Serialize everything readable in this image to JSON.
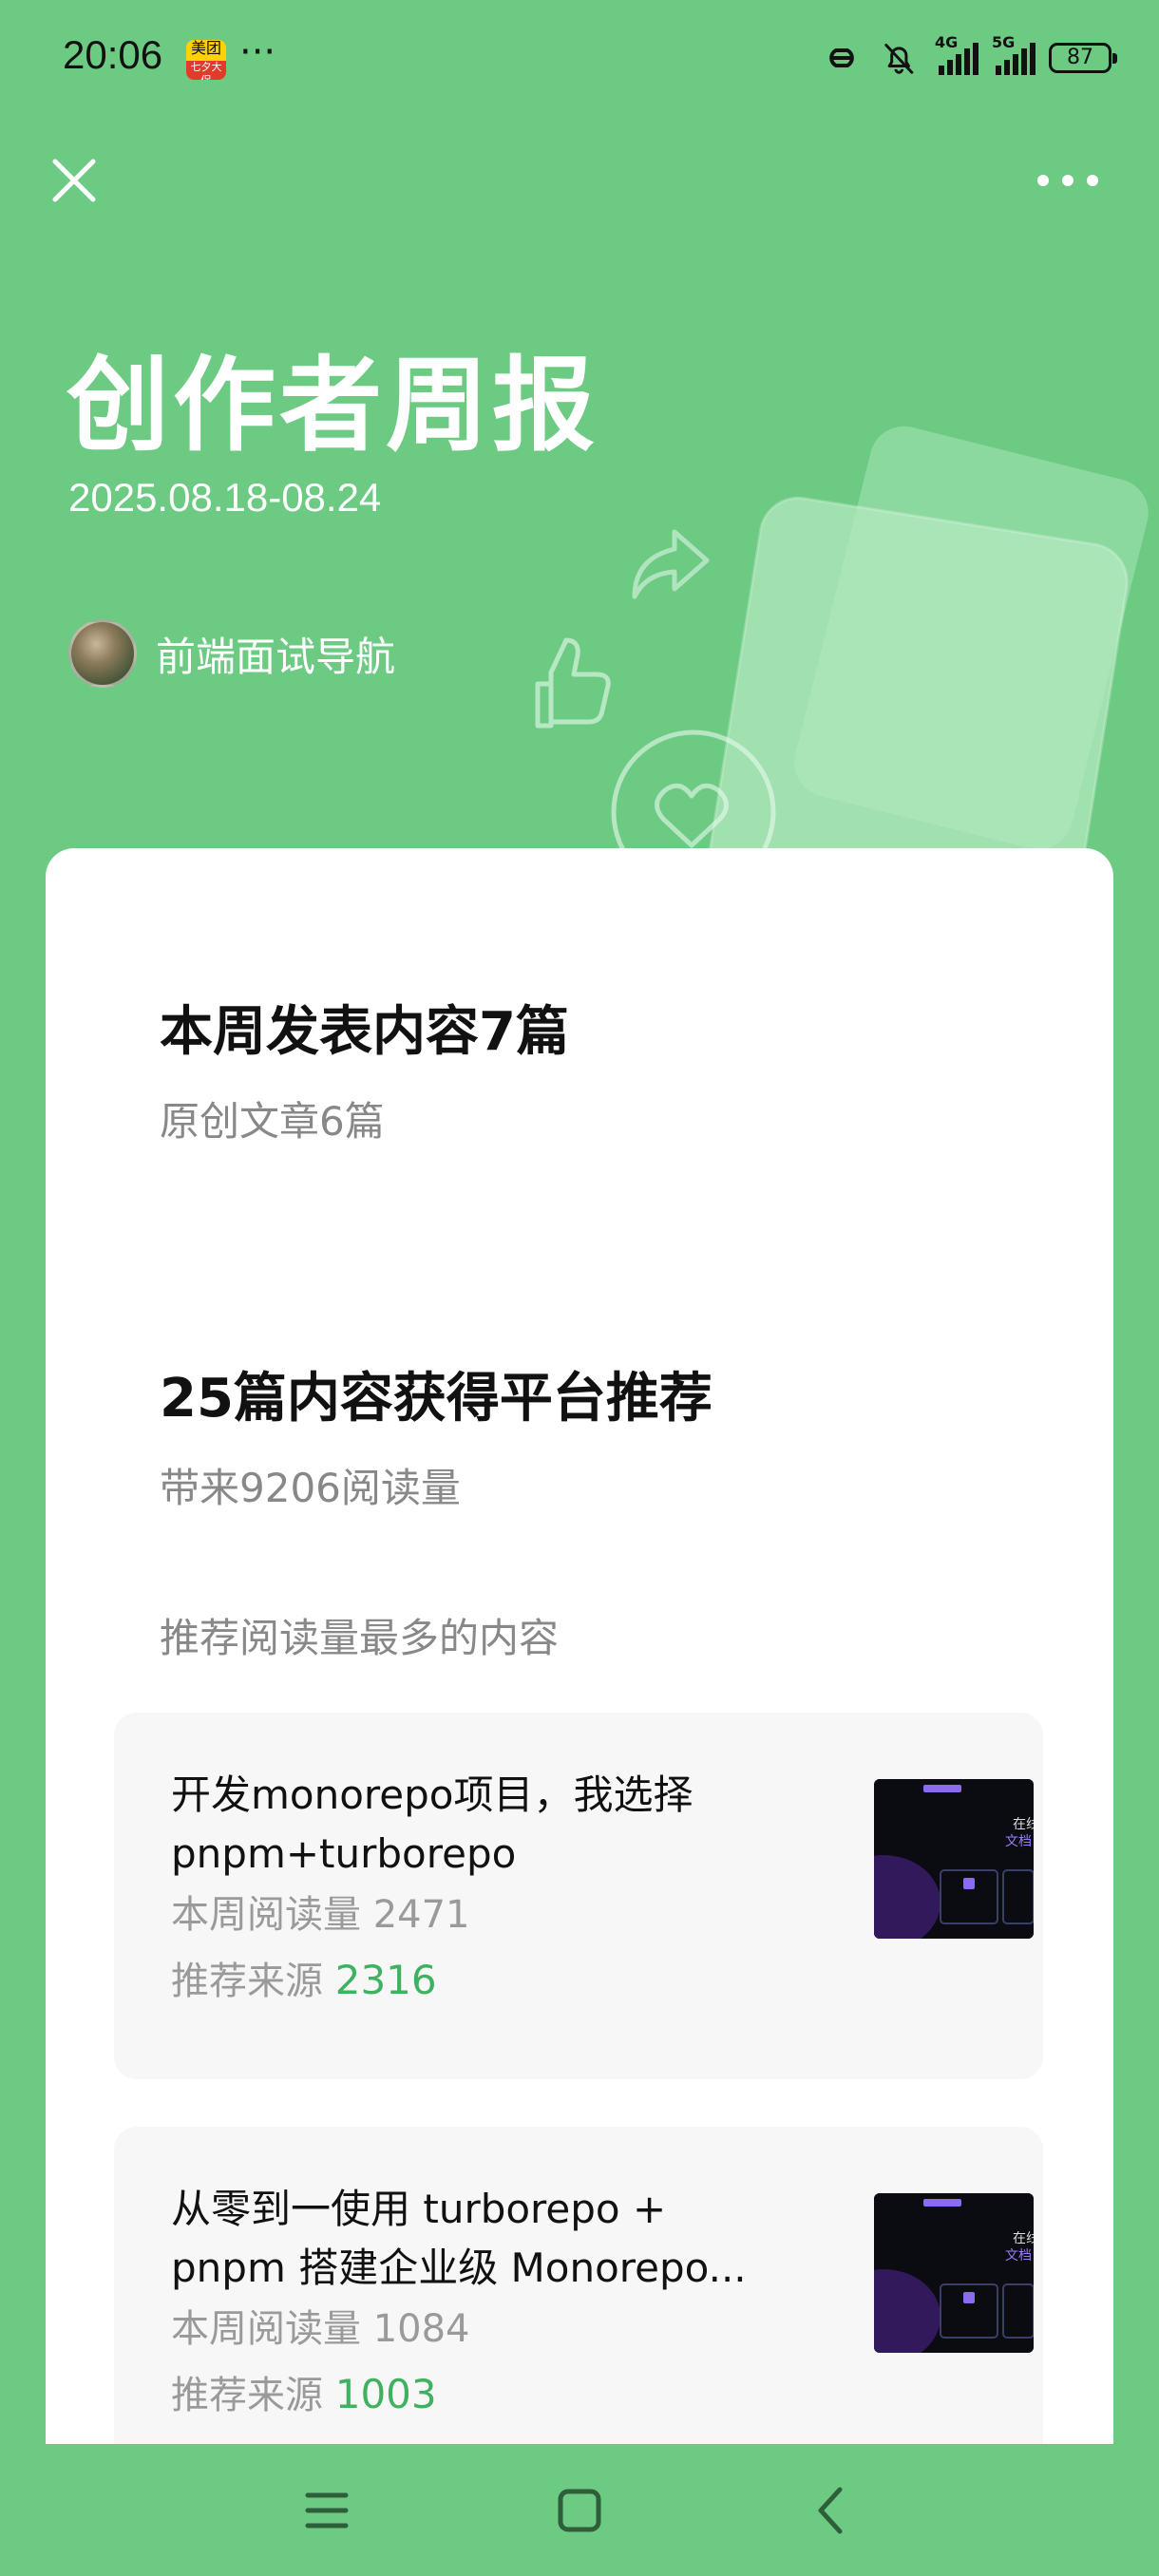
{
  "status_bar": {
    "time": "20:06",
    "meituan_badge": "美团",
    "meituan_sub": "七夕大促",
    "more_dots": "···",
    "signal1_label": "4G",
    "signal2_label": "5G",
    "battery": "87",
    "icons": [
      "link-icon",
      "mute-bell-icon",
      "signal-icon",
      "battery-icon"
    ]
  },
  "header": {
    "close_icon": "close-icon",
    "more_icon": "more-dots-icon",
    "title": "创作者周报",
    "date_range": "2025.08.18-08.24",
    "author_name": "前端面试导航"
  },
  "summary": {
    "published_title": "本周发表内容7篇",
    "published_sub": "原创文章6篇",
    "recommend_title": "25篇内容获得平台推荐",
    "recommend_sub": "带来9206阅读量",
    "top_label": "推荐阅读量最多的内容"
  },
  "articles": [
    {
      "title_line1": "开发monorepo项目，我选择",
      "title_line2": "pnpm+turborepo",
      "read_label": "本周阅读量 2471",
      "source_label": "推荐来源",
      "source_value": "2316"
    },
    {
      "title_line1": "从零到一使用 turborepo +",
      "title_line2": "pnpm 搭建企业级 Monorepo...",
      "read_label": "本周阅读量 1084",
      "source_label": "推荐来源",
      "source_value": "1003"
    }
  ],
  "nav_bar": {
    "icons": [
      "menu-icon",
      "home-square-icon",
      "back-icon"
    ]
  },
  "colors": {
    "background": "#6cca83",
    "accent_value": "#3fb160",
    "card": "#ffffff",
    "item_bg": "#f7f7f7"
  }
}
